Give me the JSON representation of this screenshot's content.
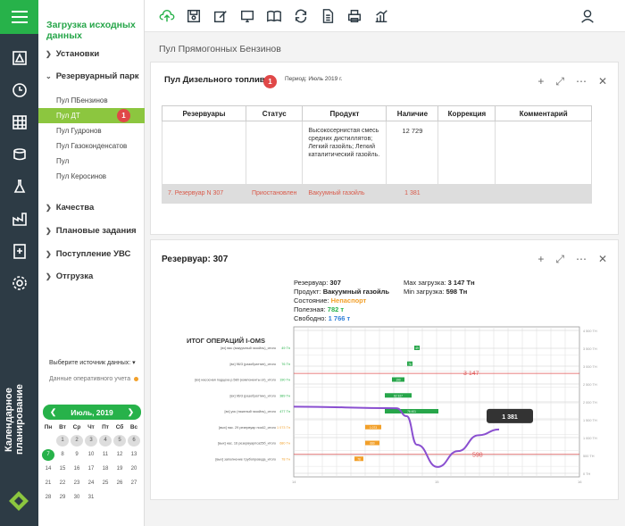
{
  "rail": {
    "vertical_label": "Календарное планирование"
  },
  "sidebar": {
    "title": "Загрузка исходных данных",
    "sections": [
      {
        "label": "Установки"
      },
      {
        "label": "Резервуарный парк"
      },
      {
        "label": "Качества"
      },
      {
        "label": "Плановые задания"
      },
      {
        "label": "Поступление УВС"
      },
      {
        "label": "Отгрузка"
      }
    ],
    "tank_items": [
      {
        "label": "Пул ПБензинов"
      },
      {
        "label": "Пул ДТ",
        "badge": "1"
      },
      {
        "label": "Пул Гудронов"
      },
      {
        "label": "Пул Газоконденсатов"
      },
      {
        "label": "Пул"
      },
      {
        "label": "Пул Керосинов"
      }
    ],
    "source_select": "Выберите источник данных:",
    "source_option": "Данные оперативного учета",
    "calendar": {
      "month": "Июль, 2019",
      "prev": "❮",
      "next": "❯",
      "weekdays": [
        "Пн",
        "Вт",
        "Ср",
        "Чт",
        "Пт",
        "Сб",
        "Вс"
      ],
      "days": [
        "",
        "1",
        "2",
        "3",
        "4",
        "5",
        "6",
        "7",
        "8",
        "9",
        "10",
        "11",
        "12",
        "13",
        "14",
        "15",
        "16",
        "17",
        "18",
        "19",
        "20",
        "21",
        "22",
        "23",
        "24",
        "25",
        "26",
        "27",
        "28",
        "29",
        "30",
        "31"
      ],
      "today": "7"
    }
  },
  "main": {
    "page_title": "Пул Прямогонных Бензинов",
    "card1": {
      "title": "Пул Дизельного топлива",
      "badge": "1",
      "period": "Период:  Июль 2019 г.",
      "columns": [
        "Резервуары",
        "Статус",
        "Продукт",
        "Наличие",
        "Коррекция",
        "Комментарий"
      ],
      "row1": {
        "product": "Высокосернистая смесь средних дистиллятов; Легкий газойль; Легкий каталитический газойль.",
        "amount": "12 729"
      },
      "row2": {
        "tank": "7. Резервуар N 307",
        "status": "Приостановлен",
        "product": "Вакуумный газойль",
        "amount": "1 381"
      }
    },
    "card2": {
      "title": "Резервуар: 307",
      "tank_label": "Резервуар:",
      "tank_value": "307",
      "product_label": "Продукт:",
      "product_value": "Вакуумный газойль",
      "state_label": "Состояние:",
      "state_value": "Непаспорт",
      "useful_label": "Полезная:",
      "useful_value": "782 т",
      "free_label": "Свободно:",
      "free_value": "1 766 т",
      "max_label": "Max загрузка:",
      "max_value": "3 147 Тн",
      "min_label": "Min загрузка:",
      "min_value": "598 Тн"
    }
  },
  "chart_data": {
    "type": "line",
    "title": "ИТОГ ОПЕРАЦИЙ I-OMS",
    "y_ticks": [
      "4 500 ТН",
      "3 500 ТН",
      "3 000 ТН",
      "2 500 ТН",
      "2 000 ТН",
      "1 500 ТН",
      "1 000 ТН",
      "500 ТН",
      "0 ТН"
    ],
    "x_ticks": [
      "14",
      "15",
      "16"
    ],
    "max_line": "3 147",
    "min_line": "598",
    "current_value": "1 381",
    "rows": [
      {
        "label": "[вх] вас (вакуумный газойль)_итого",
        "value": "49 Тн",
        "bar": "49"
      },
      {
        "label": "[вх] 96/3 (разобраттин)_итого",
        "value": "76 Тн",
        "bar": "76"
      },
      {
        "label": "[вх] насосная подцеха р.580 (компоненты ат)_итого",
        "value": "190 Тн",
        "bar": "190"
      },
      {
        "label": "[вх] 96/3 (разобраттин)_итого",
        "value": "389 Тн",
        "bar": "62 327"
      },
      {
        "label": "[вх] уск (тяжелый газойль)_итого",
        "value": "477 Тн",
        "bar": "76 401"
      },
      {
        "label": "[вых] нас. 29 резервуар поз42_итого",
        "value": "1 073 Тн",
        "bar": "1 073"
      },
      {
        "label": "[вых] нас. 16 резервуарпоз25б_итого",
        "value": "680 Тн",
        "bar": "680"
      },
      {
        "label": "[вых] заполнение трубопровода_итого",
        "value": "78 Тн",
        "bar": "78"
      }
    ],
    "series": [
      {
        "name": "",
        "points": [
          [
            0,
            2100
          ],
          [
            0.5,
            2050
          ],
          [
            0.55,
            1800
          ],
          [
            0.6,
            900
          ],
          [
            0.7,
            200
          ],
          [
            0.8,
            700
          ],
          [
            0.9,
            1200
          ],
          [
            1.0,
            1381
          ]
        ]
      }
    ]
  }
}
